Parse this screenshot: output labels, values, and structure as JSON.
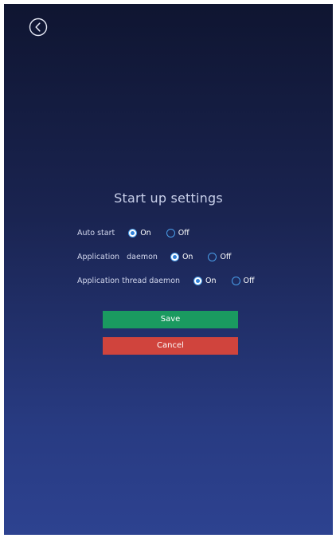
{
  "header": {
    "back_icon": "chevron-left-circle-icon"
  },
  "page": {
    "title": "Start up settings"
  },
  "settings": {
    "auto_start": {
      "label": "Auto start",
      "on_label": "On",
      "off_label": "Off",
      "selected": "On"
    },
    "application_daemon": {
      "label": "Application   daemon",
      "on_label": "On",
      "off_label": "Off",
      "selected": "On"
    },
    "application_thread_daemon": {
      "label": "Application thread daemon",
      "on_label": "On",
      "off_label": "Off",
      "selected": "On"
    }
  },
  "actions": {
    "save_label": "Save",
    "cancel_label": "Cancel"
  },
  "colors": {
    "save": "#1a9a60",
    "cancel": "#d0443d",
    "radio_accent": "#4a9de8"
  }
}
